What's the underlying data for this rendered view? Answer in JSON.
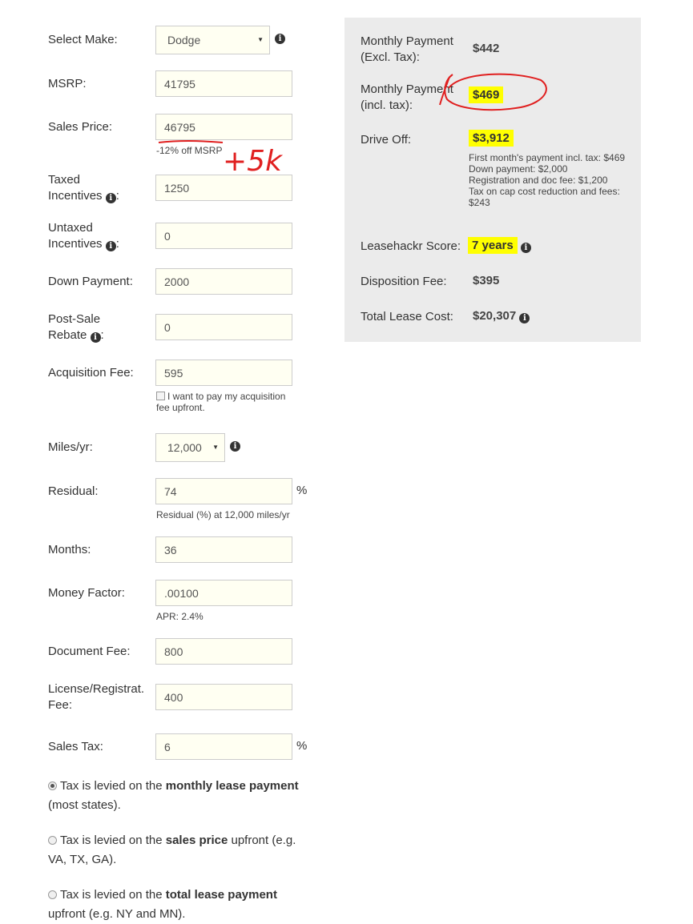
{
  "form": {
    "make": {
      "label": "Select Make:",
      "value": "Dodge"
    },
    "msrp": {
      "label": "MSRP:",
      "value": "41795"
    },
    "sales_price": {
      "label": "Sales Price:",
      "value": "46795",
      "hint": "-12% off MSRP"
    },
    "taxed_incentives": {
      "label_line1": "Taxed",
      "label_line2": "Incentives",
      "value": "1250"
    },
    "untaxed_incentives": {
      "label_line1": "Untaxed",
      "label_line2": "Incentives",
      "value": "0"
    },
    "down_payment": {
      "label": "Down Payment:",
      "value": "2000"
    },
    "post_sale_rebate": {
      "label_line1": "Post-Sale",
      "label_line2": "Rebate",
      "value": "0"
    },
    "acquisition_fee": {
      "label": "Acquisition Fee:",
      "value": "595",
      "upfront_text": "I want to pay my acquisition fee upfront."
    },
    "miles": {
      "label": "Miles/yr:",
      "value": "12,000"
    },
    "residual": {
      "label": "Residual:",
      "value": "74",
      "unit": "%",
      "hint": "Residual (%) at 12,000 miles/yr"
    },
    "months": {
      "label": "Months:",
      "value": "36"
    },
    "money_factor": {
      "label": "Money Factor:",
      "value": ".00100",
      "hint": "APR: 2.4%"
    },
    "document_fee": {
      "label": "Document Fee:",
      "value": "800"
    },
    "license_fee": {
      "label_line1": "License/Registrat.",
      "label_line2": "Fee:",
      "value": "400"
    },
    "sales_tax": {
      "label": "Sales Tax:",
      "value": "6",
      "unit": "%"
    },
    "tax_options": [
      {
        "pre": "Tax is levied on the ",
        "bold": "monthly lease payment",
        "post": " (most states).",
        "selected": true
      },
      {
        "pre": "Tax is levied on the ",
        "bold": "sales price",
        "post": " upfront (e.g. VA, TX, GA).",
        "selected": false
      },
      {
        "pre": "Tax is levied on the ",
        "bold": "total lease payment",
        "post": " upfront (e.g. NY and MN).",
        "selected": false
      }
    ]
  },
  "summary": {
    "monthly_excl": {
      "label_line1": "Monthly Payment",
      "label_line2": "(Excl. Tax):",
      "value": "$442"
    },
    "monthly_incl": {
      "label_line1": "Monthly Payment",
      "label_line2": "(incl. tax):",
      "value": "$469"
    },
    "drive_off": {
      "label": "Drive Off:",
      "value": "$3,912",
      "breakdown": [
        "First month's payment incl. tax: $469",
        "Down payment: $2,000",
        "Registration and doc fee: $1,200",
        "Tax on cap cost reduction and fees: $243"
      ]
    },
    "score": {
      "label": "Leasehackr Score:",
      "value": "7 years"
    },
    "disposition": {
      "label": "Disposition Fee:",
      "value": "$395"
    },
    "total": {
      "label": "Total Lease Cost:",
      "value": "$20,307"
    }
  },
  "annotation": {
    "text": "+5k",
    "color": "#e02020"
  },
  "colors": {
    "highlight": "#ffff00",
    "panel": "#ebebeb",
    "input_bg": "#fffff2"
  }
}
